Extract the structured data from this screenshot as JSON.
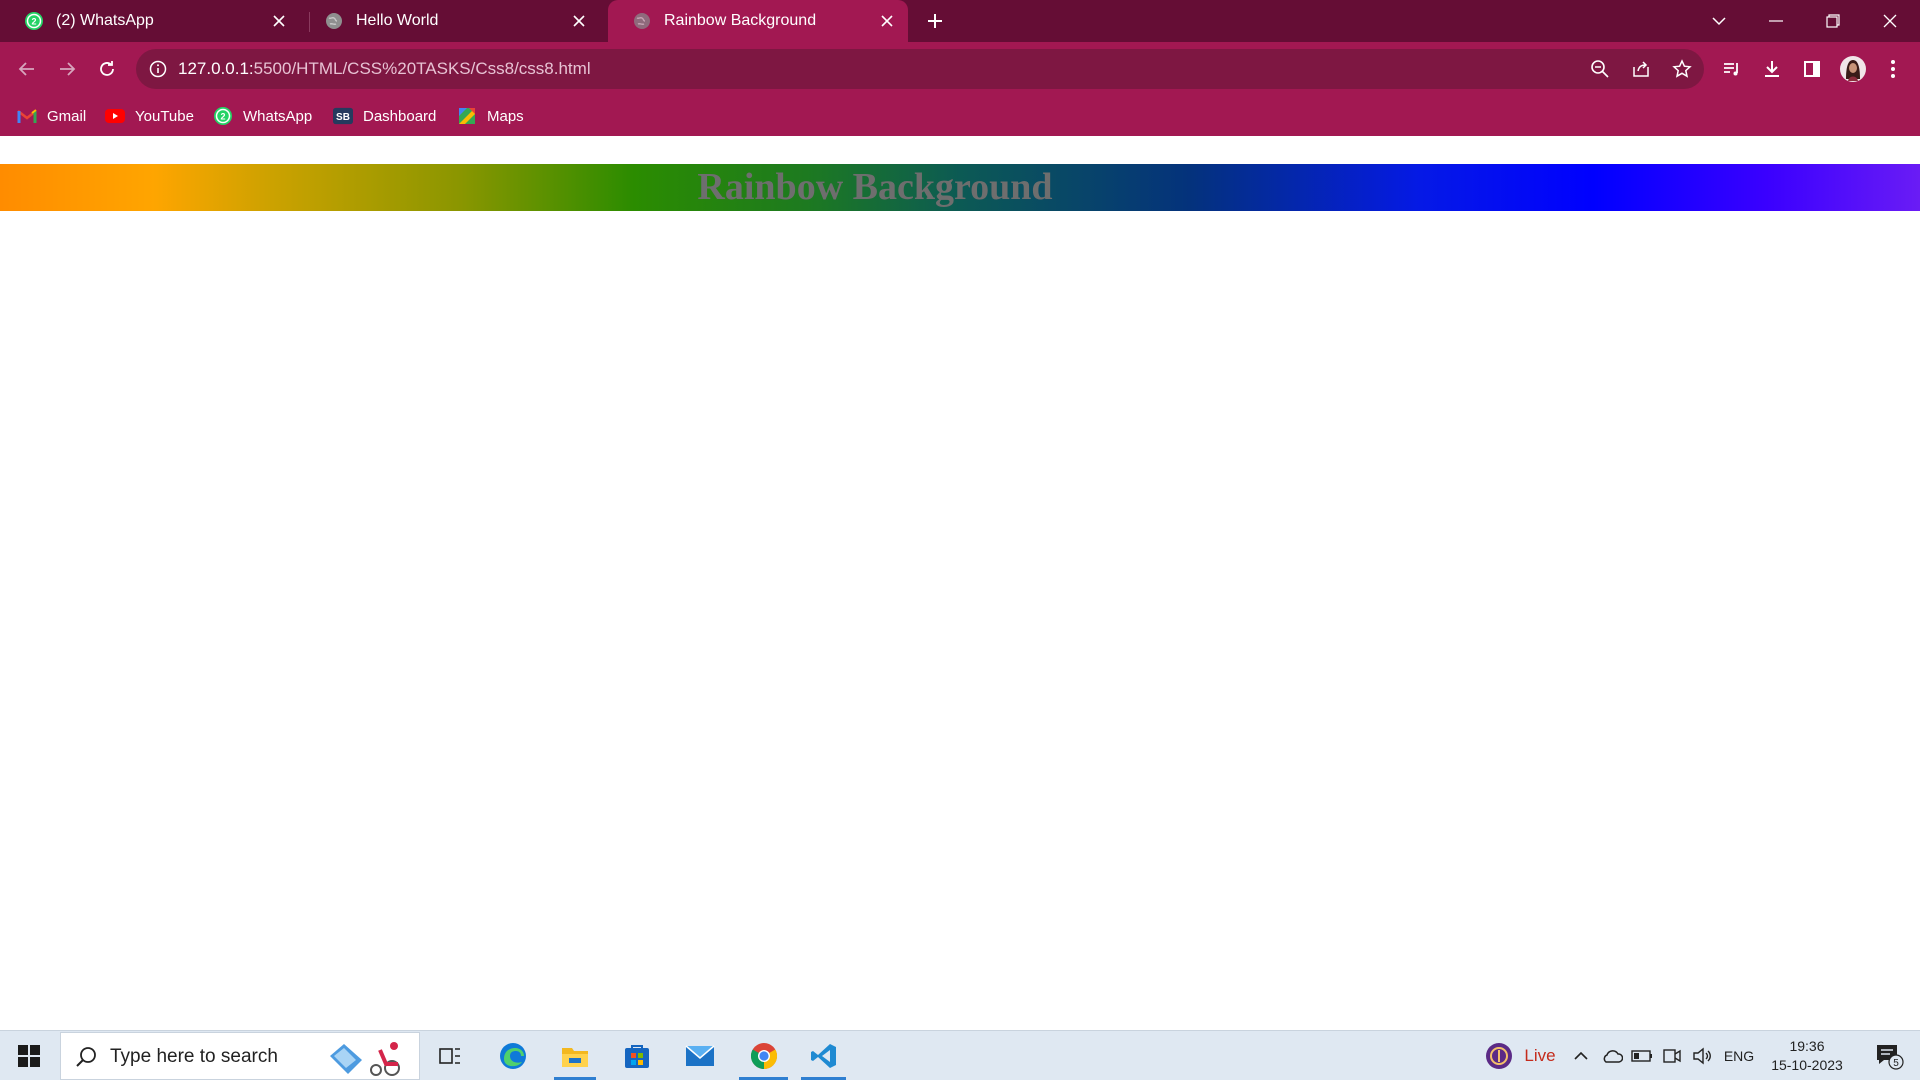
{
  "browser": {
    "tabs": [
      {
        "title": "(2) WhatsApp",
        "favicon": "whatsapp-icon"
      },
      {
        "title": "Hello World",
        "favicon": "globe-icon"
      },
      {
        "title": "Rainbow Background",
        "favicon": "globe-icon"
      }
    ],
    "active_tab_index": 2,
    "url_host": "127.0.0.1:",
    "url_path": "5500/HTML/CSS%20TASKS/Css8/css8.html",
    "colors": {
      "frame": "#650d35",
      "toolbar": "#a21852",
      "omnibox": "#7e1742"
    }
  },
  "bookmarks": [
    {
      "label": "Gmail",
      "icon": "gmail-icon"
    },
    {
      "label": "YouTube",
      "icon": "youtube-icon"
    },
    {
      "label": "WhatsApp",
      "icon": "whatsapp-icon"
    },
    {
      "label": "Dashboard",
      "icon": "sb-icon",
      "icon_text": "SB"
    },
    {
      "label": "Maps",
      "icon": "maps-icon"
    }
  ],
  "page": {
    "heading": "Rainbow Background"
  },
  "taskbar": {
    "search_placeholder": "Type here to search",
    "apps": [
      "task-view-icon",
      "edge-icon",
      "file-explorer-icon",
      "store-icon",
      "mail-icon",
      "chrome-icon",
      "vscode-icon"
    ],
    "live_label": "Live",
    "language": "ENG",
    "time": "19:36",
    "date": "15-10-2023",
    "notification_count": "5"
  },
  "whatsapp_badge": "2"
}
